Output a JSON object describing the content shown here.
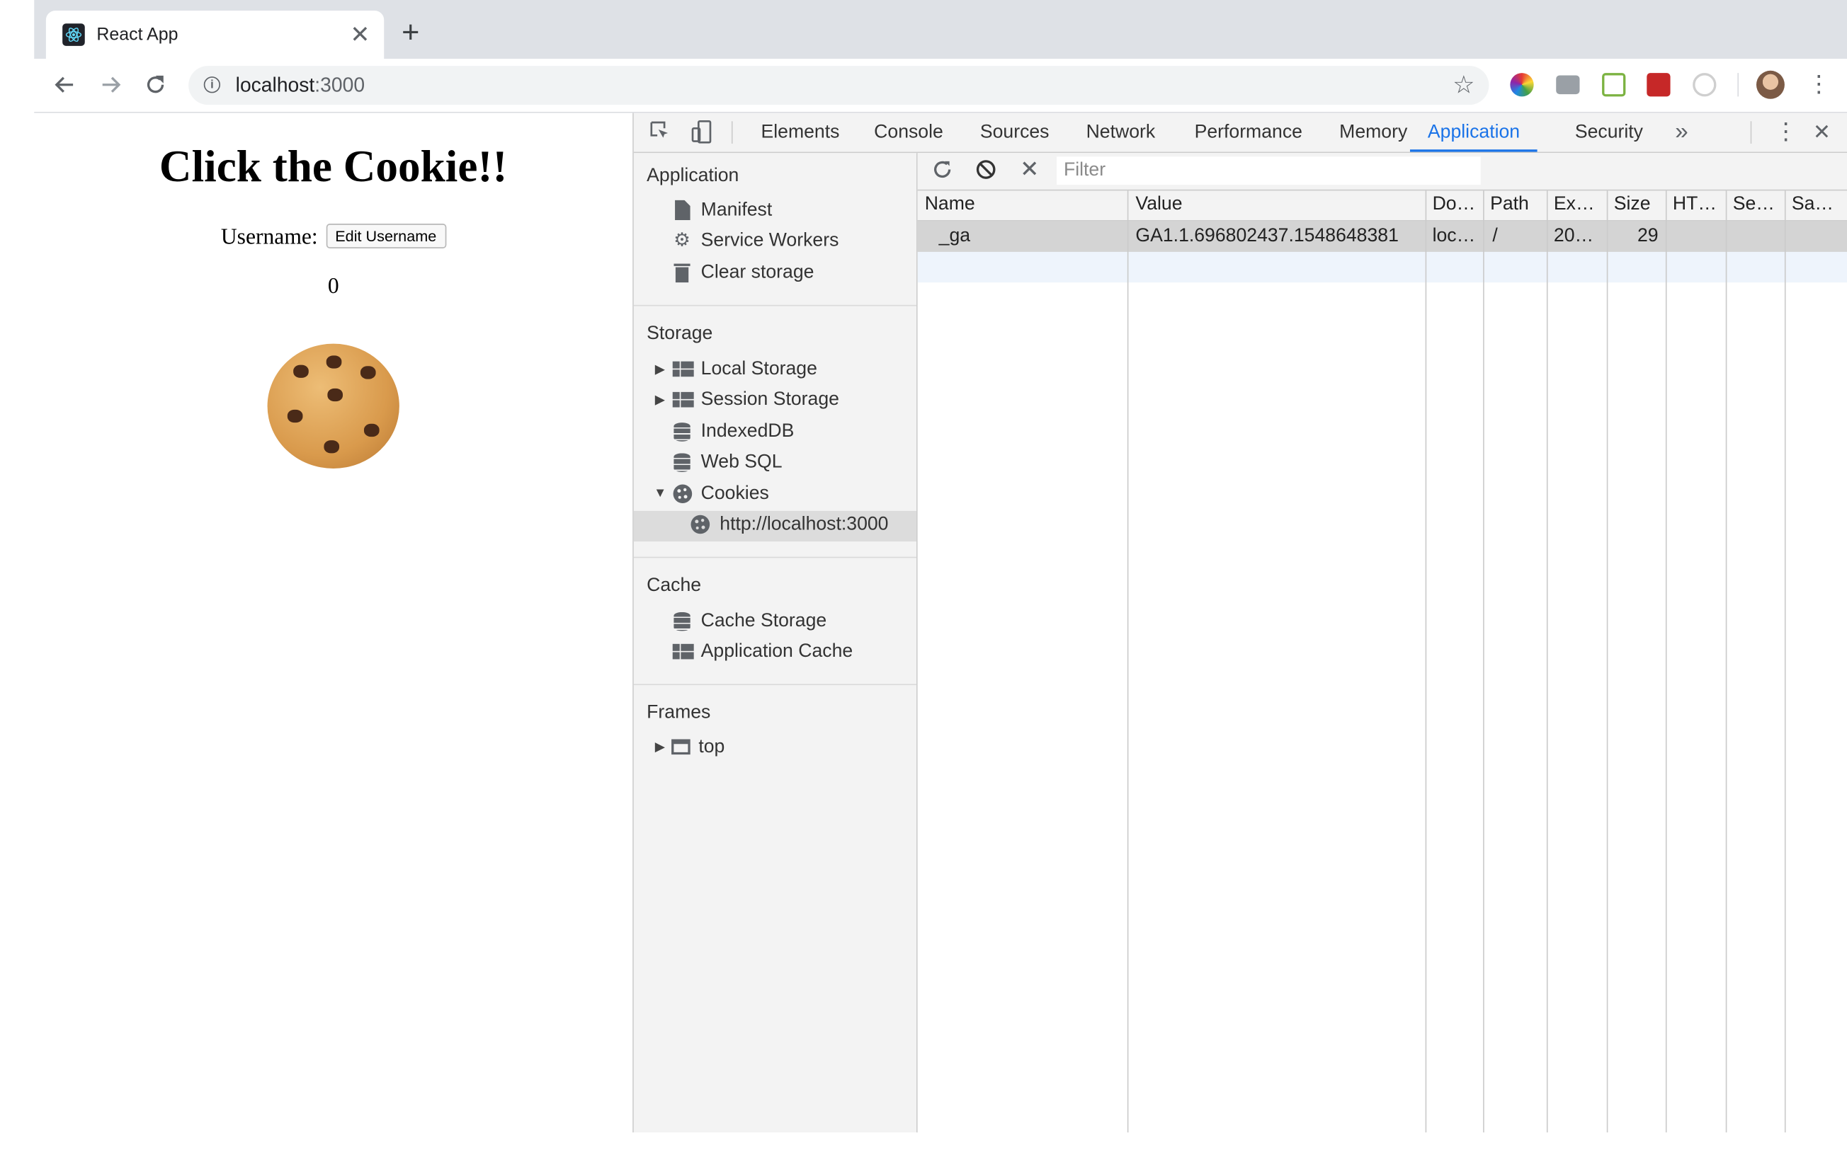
{
  "browser": {
    "tab_title": "React App",
    "tab_close": "✕",
    "new_tab": "+",
    "url_host": "localhost",
    "url_port": ":3000"
  },
  "page": {
    "title": "Click the Cookie!!",
    "username_label": "Username:",
    "edit_button": "Edit Username",
    "count": "0"
  },
  "devtools": {
    "tabs": [
      "Elements",
      "Console",
      "Sources",
      "Network",
      "Performance",
      "Memory",
      "Application",
      "Security"
    ],
    "active_tab": "Application",
    "more": "»",
    "close": "✕",
    "filter_placeholder": "Filter",
    "sidebar": {
      "application": {
        "title": "Application",
        "items": [
          "Manifest",
          "Service Workers",
          "Clear storage"
        ]
      },
      "storage": {
        "title": "Storage",
        "items": [
          "Local Storage",
          "Session Storage",
          "IndexedDB",
          "Web SQL",
          "Cookies"
        ],
        "cookie_origin": "http://localhost:3000"
      },
      "cache": {
        "title": "Cache",
        "items": [
          "Cache Storage",
          "Application Cache"
        ]
      },
      "frames": {
        "title": "Frames",
        "items": [
          "top"
        ]
      }
    },
    "cookies_table": {
      "columns": [
        "Name",
        "Value",
        "Do…",
        "Path",
        "Ex…",
        "Size",
        "HT…",
        "Se…",
        "Sa…"
      ],
      "rows": [
        {
          "name": "_ga",
          "value": "GA1.1.696802437.1548648381",
          "domain": "loc…",
          "path": "/",
          "expires": "20…",
          "size": "29",
          "http": "",
          "secure": "",
          "samesite": ""
        }
      ]
    }
  }
}
